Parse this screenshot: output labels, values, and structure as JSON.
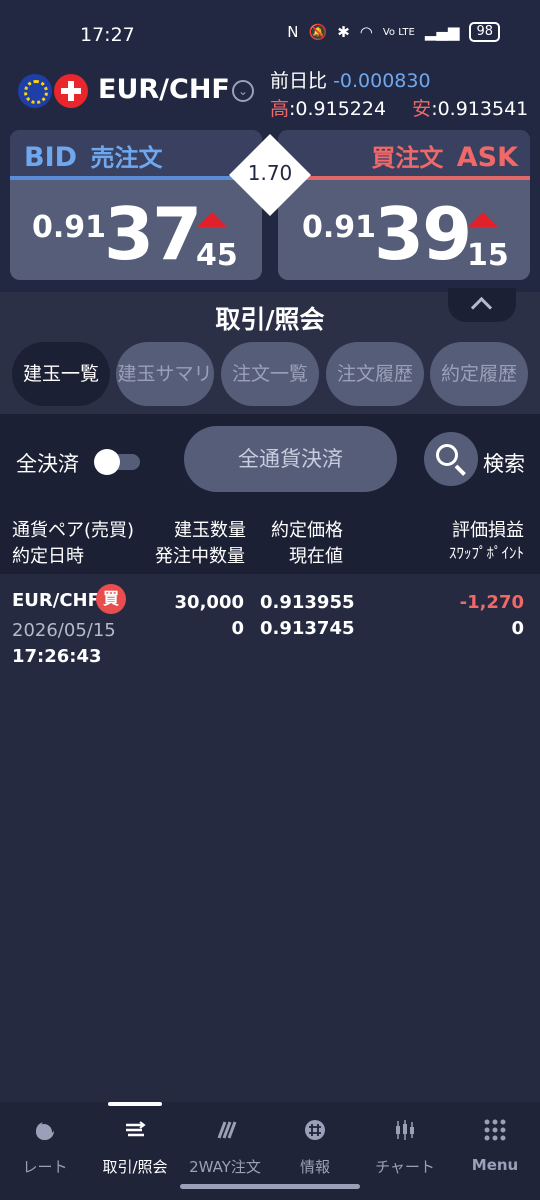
{
  "status": {
    "time": "17:27",
    "battery": "98",
    "network": "Vo LTE"
  },
  "header": {
    "pair": "EUR/CHF",
    "change_label": "前日比",
    "change_value": "-0.000830",
    "high_label": "高",
    "high_value": ":0.915224",
    "low_label": "安",
    "low_value": ":0.913541"
  },
  "quote": {
    "bid_label": "BID",
    "sell_label": "売注文",
    "buy_label": "買注文",
    "ask_label": "ASK",
    "spread": "1.70",
    "bid": {
      "prefix": "0.91",
      "big": "37",
      "tail": "45"
    },
    "ask": {
      "prefix": "0.91",
      "big": "39",
      "tail": "15"
    }
  },
  "section_title": "取引/照会",
  "tabs": [
    "建玉一覧",
    "建玉サマリ",
    "注文一覧",
    "注文履歴",
    "約定履歴"
  ],
  "actions": {
    "close_all_label": "全決済",
    "all_currency_close": "全通貨決済",
    "search_label": "検索"
  },
  "table": {
    "headers": {
      "pair": "通貨ペア(売買)",
      "exec_datetime": "約定日時",
      "position_qty": "建玉数量",
      "pending_qty": "発注中数量",
      "exec_price": "約定価格",
      "current_price": "現在値",
      "pnl": "評価損益",
      "swap": "ｽﾜｯﾌﾟﾎﾟｲﾝﾄ"
    },
    "rows": [
      {
        "pair": "EUR/CHF",
        "side": "買",
        "date": "2026/05/15",
        "time": "17:26:43",
        "position_qty": "30,000",
        "pending_qty": "0",
        "exec_price": "0.913955",
        "current_price": "0.913745",
        "pnl": "-1,270",
        "swap": "0"
      }
    ]
  },
  "nav": [
    {
      "label": "レート",
      "icon": "rate-icon"
    },
    {
      "label": "取引/照会",
      "icon": "trade-icon"
    },
    {
      "label": "2WAY注文",
      "icon": "2way-icon"
    },
    {
      "label": "情報",
      "icon": "info-icon"
    },
    {
      "label": "チャート",
      "icon": "chart-icon"
    },
    {
      "label": "Menu",
      "icon": "menu-grid-icon"
    }
  ],
  "colors": {
    "bid_blue": "#6fa8ee",
    "ask_red": "#f06868",
    "loss_red": "#f06868",
    "up_arrow": "#e0202a",
    "background": "#1c2034"
  }
}
